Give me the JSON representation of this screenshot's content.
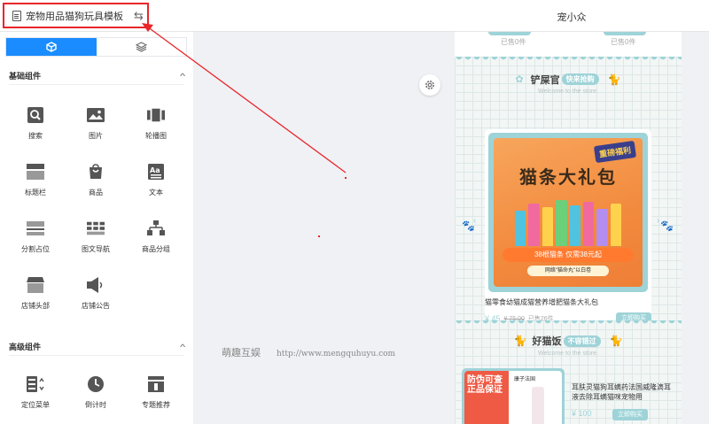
{
  "header": {
    "template_title": "宠物用品猫狗玩具模板",
    "swap_icon": "⇆",
    "shop_name": "宠小众"
  },
  "sidebar": {
    "tabs": [
      {
        "name": "cube-icon",
        "active": true
      },
      {
        "name": "layers-icon",
        "active": false
      }
    ],
    "basic_section": {
      "title": "基础组件",
      "items": [
        {
          "label": "搜索",
          "icon": "search-icon"
        },
        {
          "label": "图片",
          "icon": "image-icon"
        },
        {
          "label": "轮播图",
          "icon": "carousel-icon"
        },
        {
          "label": "标题栏",
          "icon": "title-bar-icon"
        },
        {
          "label": "商品",
          "icon": "product-icon"
        },
        {
          "label": "文本",
          "icon": "text-icon"
        },
        {
          "label": "分割占位",
          "icon": "divider-icon"
        },
        {
          "label": "图文导航",
          "icon": "grid-nav-icon"
        },
        {
          "label": "商品分组",
          "icon": "product-group-icon"
        },
        {
          "label": "店铺头部",
          "icon": "shop-header-icon"
        },
        {
          "label": "店铺公告",
          "icon": "announcement-icon"
        }
      ]
    },
    "advanced_section": {
      "title": "高级组件",
      "items": [
        {
          "label": "定位菜单",
          "icon": "location-menu-icon"
        },
        {
          "label": "倒计时",
          "icon": "countdown-icon"
        },
        {
          "label": "专题推荐",
          "icon": "topic-recommend-icon"
        }
      ]
    }
  },
  "watermark": {
    "name": "萌趣互娱",
    "url": "http://www.mengquhuyu.com"
  },
  "preview": {
    "sold_left": "已售0件",
    "sold_right": "已售0件",
    "section1": {
      "title_left": "铲屎官",
      "title_pill": "快来抢购",
      "subtitle": "Welcome to the store."
    },
    "product1": {
      "image_title": "猫条大礼包",
      "image_badge": "重磅福利",
      "image_banner": "38根猫条 仅需38元起",
      "image_sub": "网络\"猫命丸\"以白卷",
      "name": "猫零食幼猫成猫营养增肥猫条大礼包",
      "price": "¥ 45",
      "old_price": "¥ 75.00",
      "sold": "已售26件",
      "buy_label": "立即购买"
    },
    "section2": {
      "title_left": "好猫饭",
      "title_pill": "不容错过",
      "subtitle": "Welcome to the store."
    },
    "product2": {
      "image_text": "防伪可查 正品保证",
      "image_brand": "康子法国",
      "name": "耳肤灵猫狗耳螨药法国威隆滴耳液去除耳螨猫咪宠物用",
      "price": "¥ 100",
      "buy_label": "立即购买"
    }
  },
  "colors": {
    "accent": "#1a8cff",
    "theme": "#9ed3d8",
    "highlight": "#e8262a"
  }
}
